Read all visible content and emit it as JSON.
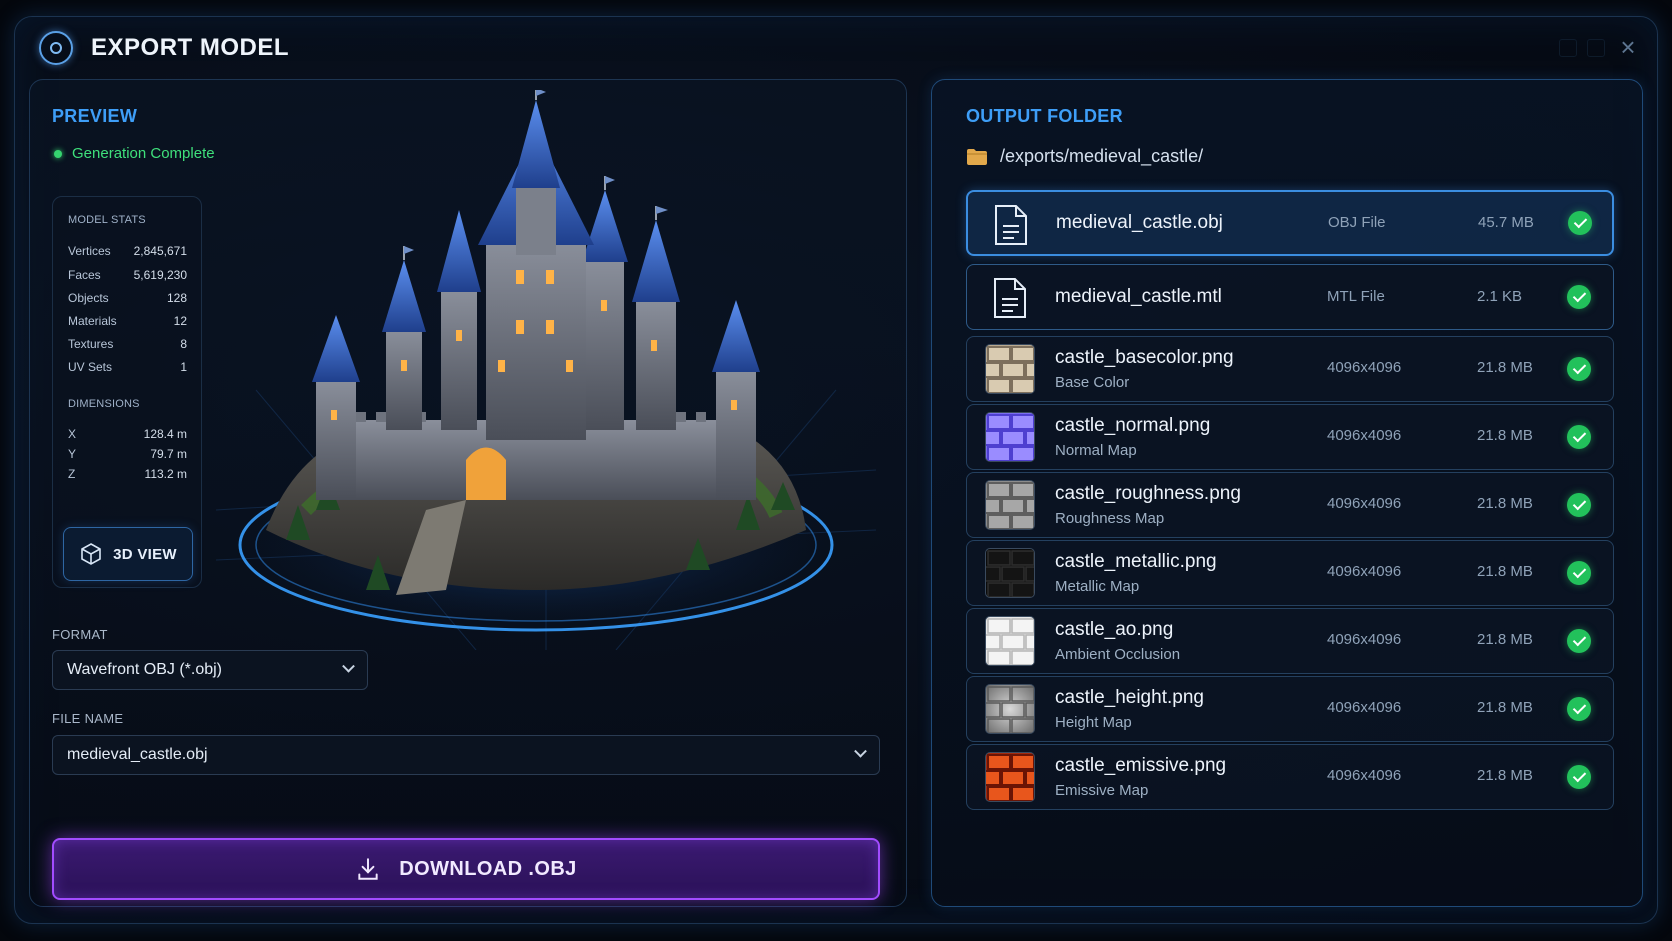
{
  "window": {
    "title": "EXPORT MODEL"
  },
  "preview": {
    "section_title": "PREVIEW",
    "status": "Generation Complete",
    "stats_title": "MODEL STATS",
    "stats": [
      {
        "label": "Vertices",
        "value": "2,845,671"
      },
      {
        "label": "Faces",
        "value": "5,619,230"
      },
      {
        "label": "Objects",
        "value": "128"
      },
      {
        "label": "Materials",
        "value": "12"
      },
      {
        "label": "Textures",
        "value": "8"
      },
      {
        "label": "UV Sets",
        "value": "1"
      }
    ],
    "dimensions_title": "DIMENSIONS",
    "dimensions": [
      {
        "axis": "X",
        "value": "128.4 m"
      },
      {
        "axis": "Y",
        "value": "79.7 m"
      },
      {
        "axis": "Z",
        "value": "113.2 m"
      }
    ],
    "view_3d_label": "3D VIEW"
  },
  "export": {
    "format_label": "FORMAT",
    "format_value": "Wavefront OBJ (*.obj)",
    "filename_label": "FILE NAME",
    "filename_value": "medieval_castle.obj",
    "download_label": "DOWNLOAD .OBJ"
  },
  "output": {
    "section_title": "OUTPUT FOLDER",
    "folder_path": "/exports/medieval_castle/",
    "files": [
      {
        "name": "medieval_castle.obj",
        "subtitle": "",
        "type": "OBJ File",
        "size": "45.7 MB",
        "icon": "document-icon",
        "status": "complete"
      },
      {
        "name": "medieval_castle.mtl",
        "subtitle": "",
        "type": "MTL File",
        "size": "2.1 KB",
        "icon": "document-icon",
        "status": "complete"
      },
      {
        "name": "castle_basecolor.png",
        "subtitle": "Base Color",
        "type": "4096x4096",
        "size": "21.8 MB",
        "icon": "basecolor-thumbnail",
        "status": "complete"
      },
      {
        "name": "castle_normal.png",
        "subtitle": "Normal Map",
        "type": "4096x4096",
        "size": "21.8 MB",
        "icon": "normal-thumbnail",
        "status": "complete"
      },
      {
        "name": "castle_roughness.png",
        "subtitle": "Roughness Map",
        "type": "4096x4096",
        "size": "21.8 MB",
        "icon": "roughness-thumbnail",
        "status": "complete"
      },
      {
        "name": "castle_metallic.png",
        "subtitle": "Metallic Map",
        "type": "4096x4096",
        "size": "21.8 MB",
        "icon": "metallic-thumbnail",
        "status": "complete"
      },
      {
        "name": "castle_ao.png",
        "subtitle": "Ambient Occlusion",
        "type": "4096x4096",
        "size": "21.8 MB",
        "icon": "ao-thumbnail",
        "status": "complete"
      },
      {
        "name": "castle_height.png",
        "subtitle": "Height Map",
        "type": "4096x4096",
        "size": "21.8 MB",
        "icon": "height-thumbnail",
        "status": "complete"
      },
      {
        "name": "castle_emissive.png",
        "subtitle": "Emissive Map",
        "type": "4096x4096",
        "size": "21.8 MB",
        "icon": "emissive-thumbnail",
        "status": "complete"
      }
    ]
  },
  "colors": {
    "accent_blue": "#3e9ef7",
    "success_green": "#22c15b",
    "download_purple": "#a24cff",
    "background": "#070d18"
  }
}
